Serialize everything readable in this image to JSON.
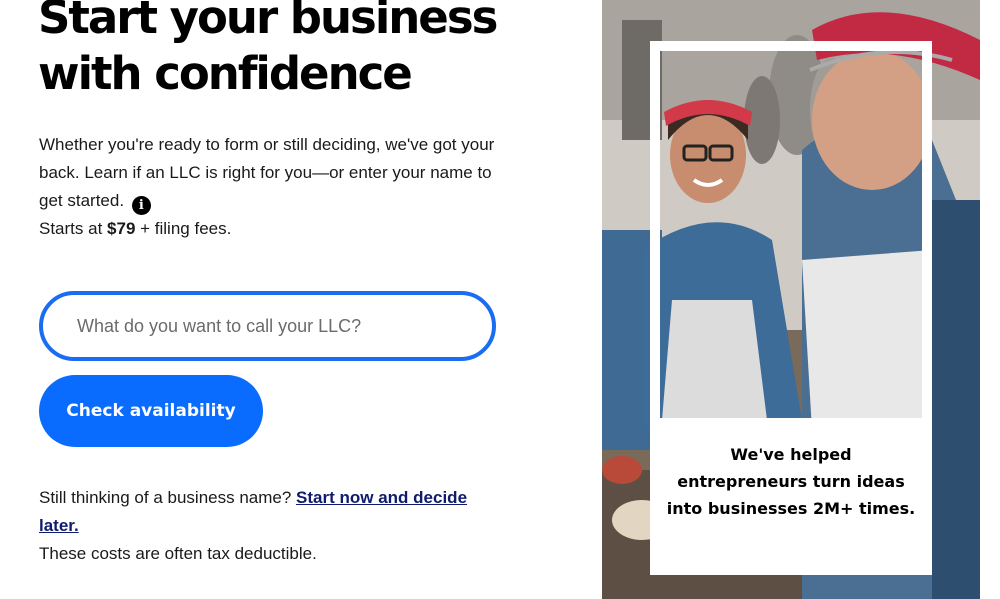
{
  "hero": {
    "headline_line1": "Start your business",
    "headline_line2": "with confidence",
    "intro": "Whether you're ready to form or still deciding, we've got your back. Learn if an LLC is right for you—or enter your name to get started.",
    "info_icon": "info-icon",
    "price_prefix": "Starts at ",
    "price": "$79",
    "price_suffix": " + filing fees."
  },
  "form": {
    "input_placeholder": "What do you want to call your LLC?",
    "input_value": "",
    "button_label": "Check availability"
  },
  "footer": {
    "prompt": "Still thinking of a business name? ",
    "link_label": "Start now and decide later.",
    "note": "These costs are often tax deductible."
  },
  "photo": {
    "caption": "We've helped entrepreneurs turn ideas into businesses 2M+ times."
  },
  "colors": {
    "accent": "#0a6cff",
    "input_border": "#1a6cf2",
    "link": "#0f1b6e"
  }
}
